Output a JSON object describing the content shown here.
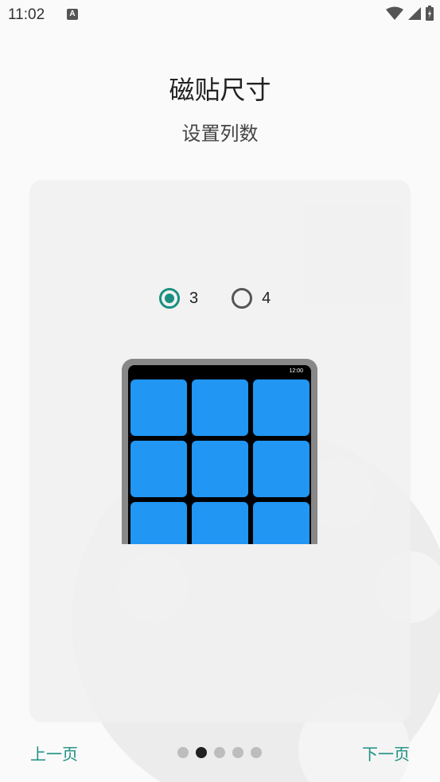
{
  "status_bar": {
    "time": "11:02",
    "app_icon_letter": "A",
    "icons": [
      "wifi-icon",
      "signal-icon",
      "battery-icon"
    ]
  },
  "header": {
    "title": "磁贴尺寸",
    "subtitle": "设置列数"
  },
  "options": [
    {
      "label": "3",
      "selected": true
    },
    {
      "label": "4",
      "selected": false
    }
  ],
  "preview": {
    "time": "12:00",
    "columns": 3,
    "tile_color": "#2196f3"
  },
  "navigation": {
    "prev_label": "上一页",
    "next_label": "下一页",
    "page_count": 5,
    "current_page": 2
  },
  "colors": {
    "accent": "#1a9080",
    "background": "#fafafa"
  }
}
